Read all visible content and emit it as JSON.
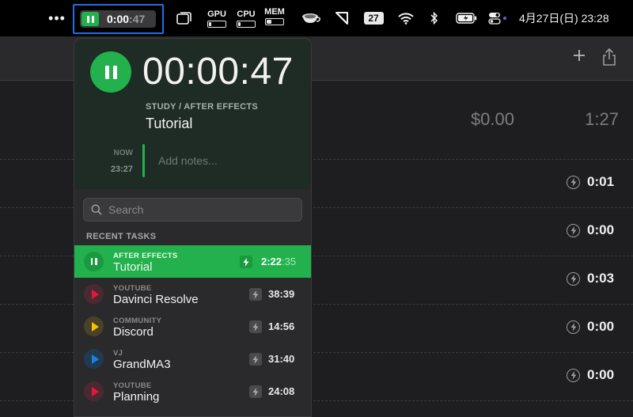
{
  "menubar": {
    "dots": "•••",
    "timer": {
      "main": "0:00",
      "dim": ":47"
    },
    "gpu_label": "GPU",
    "cpu_label": "CPU",
    "mem_label": "MEM",
    "calendar_day": "27",
    "clock": "4月27日(日)  23:28"
  },
  "background": {
    "amount": "$0.00",
    "total": "1:27",
    "durations": [
      "0:01",
      "0:00",
      "0:03",
      "0:00",
      "0:00"
    ]
  },
  "popover": {
    "elapsed": "00:00:47",
    "project": "STUDY / AFTER EFFECTS",
    "task": "Tutorial",
    "now_label": "NOW",
    "now_time": "23:27",
    "notes_placeholder": "Add notes...",
    "search_placeholder": "Search",
    "recent_label": "RECENT TASKS",
    "tasks": [
      {
        "project": "AFTER EFFECTS",
        "name": "Tutorial",
        "duration": "2:22",
        "seconds": ":35",
        "color": "#22b14c",
        "active": true
      },
      {
        "project": "YOUTUBE",
        "name": "Davinci Resolve",
        "duration": "38:39",
        "color": "#e5173f"
      },
      {
        "project": "COMMUNITY",
        "name": "Discord",
        "duration": "14:56",
        "color": "#f5c100"
      },
      {
        "project": "VJ",
        "name": "GrandMA3",
        "duration": "31:40",
        "color": "#1a7fe0"
      },
      {
        "project": "YOUTUBE",
        "name": "Planning",
        "duration": "24:08",
        "color": "#e5173f"
      }
    ]
  }
}
